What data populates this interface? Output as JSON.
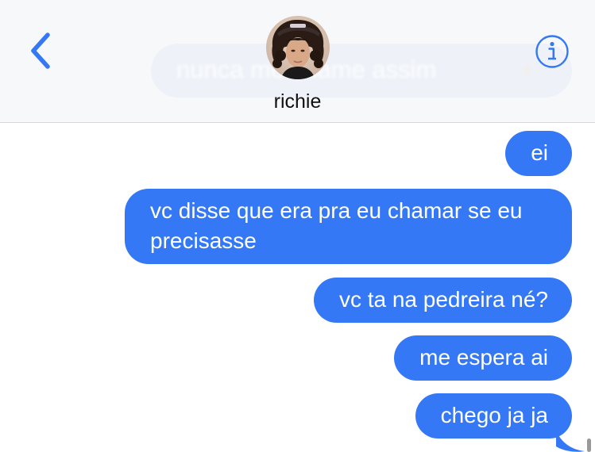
{
  "header": {
    "contact_name": "richie",
    "ghost_preview": "nunca me chame assim"
  },
  "icons": {
    "back": "chevron-left-icon",
    "info": "info-circle-icon"
  },
  "colors": {
    "accent": "#3478f6",
    "header_bg": "#f7f8fa",
    "bubble_text": "#ffffff"
  },
  "messages": [
    {
      "sender": "me",
      "text": "ei"
    },
    {
      "sender": "me",
      "text": "vc disse que era pra eu chamar se eu precisasse"
    },
    {
      "sender": "me",
      "text": "vc ta na pedreira né?"
    },
    {
      "sender": "me",
      "text": "me espera ai"
    },
    {
      "sender": "me",
      "text": "chego ja ja"
    }
  ]
}
